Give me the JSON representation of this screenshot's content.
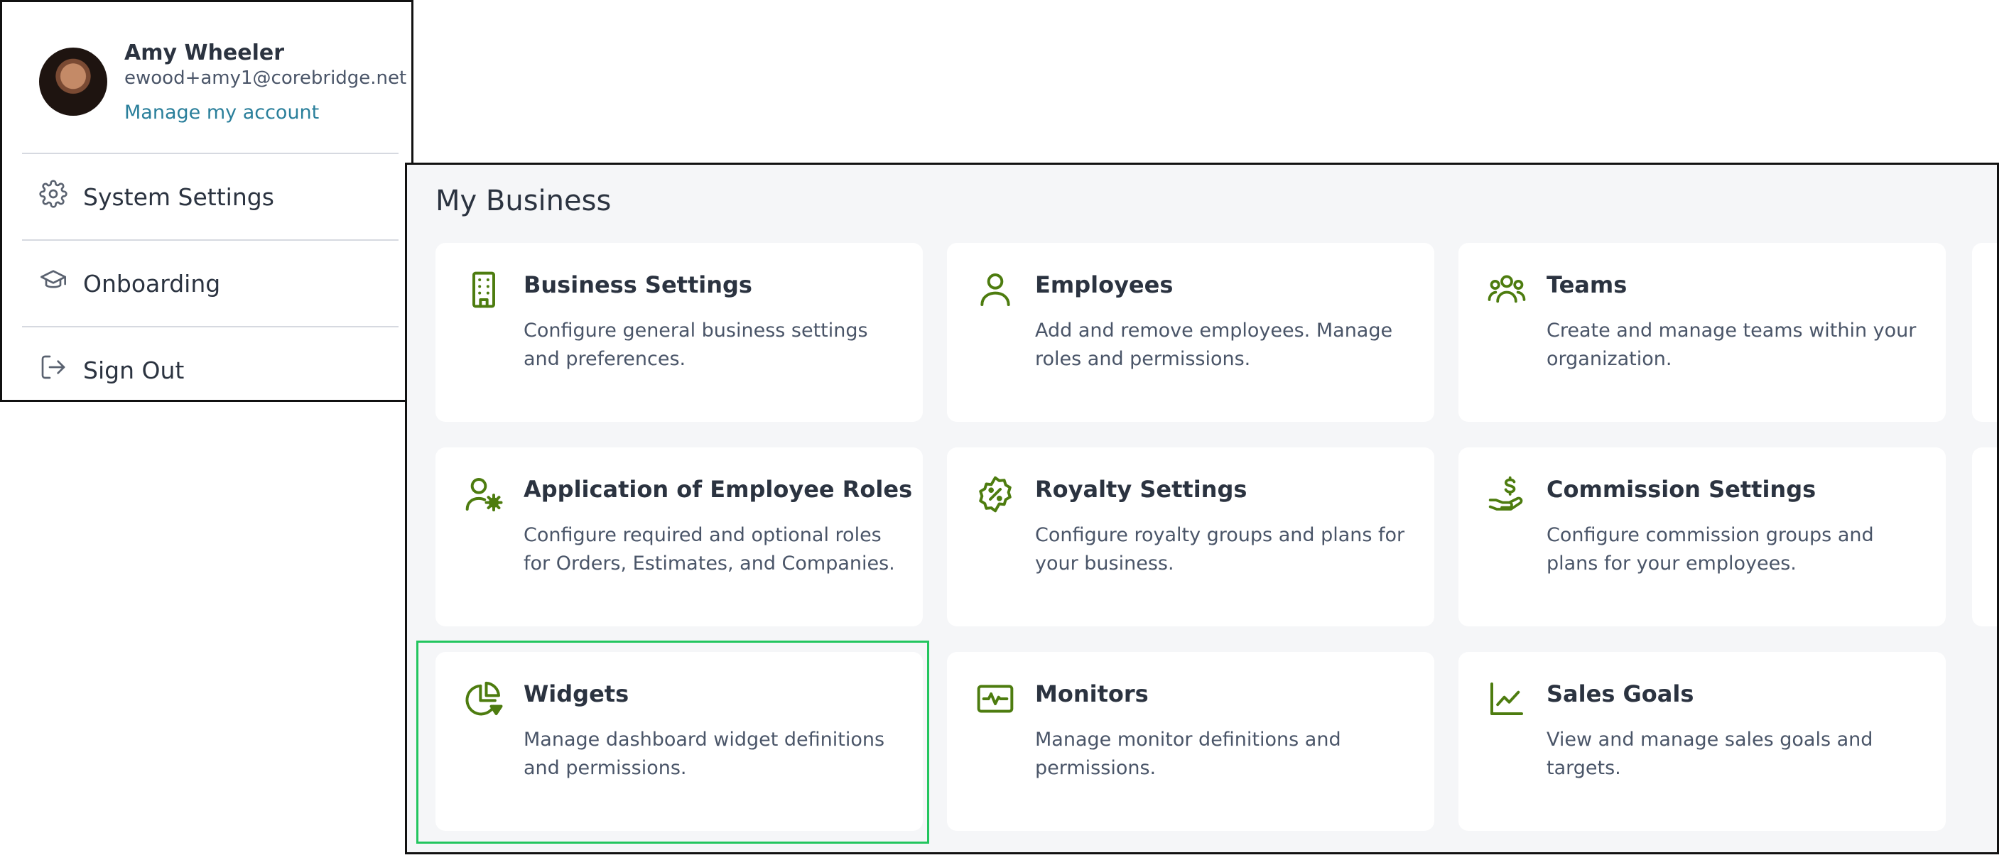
{
  "account": {
    "name": "Amy Wheeler",
    "email": "ewood+amy1@corebridge.net",
    "manage_link": "Manage my account",
    "menu": [
      {
        "label": "System Settings",
        "icon": "gear-icon"
      },
      {
        "label": "Onboarding",
        "icon": "graduation-cap-icon"
      },
      {
        "label": "Sign Out",
        "icon": "sign-out-icon"
      }
    ]
  },
  "business": {
    "title": "My Business",
    "accent_color": "#4d7c0f",
    "selection_color": "#22c55e",
    "cards": [
      {
        "title": "Business Settings",
        "desc": "Configure general business settings and preferences.",
        "icon": "building-icon"
      },
      {
        "title": "Employees",
        "desc": "Add and remove employees. Manage roles and permissions.",
        "icon": "user-icon"
      },
      {
        "title": "Teams",
        "desc": "Create and manage teams within your organization.",
        "icon": "users-icon"
      },
      {
        "title": "Application of Employee Roles",
        "desc": "Configure required and optional roles for Orders, Estimates, and Companies.",
        "icon": "user-cog-icon"
      },
      {
        "title": "Royalty Settings",
        "desc": "Configure royalty groups and plans for your business.",
        "icon": "percent-badge-icon"
      },
      {
        "title": "Commission Settings",
        "desc": "Configure commission groups and plans for your employees.",
        "icon": "hand-coin-icon"
      },
      {
        "title": "Widgets",
        "desc": "Manage dashboard widget definitions and permissions.",
        "icon": "pie-chart-icon"
      },
      {
        "title": "Monitors",
        "desc": "Manage monitor definitions and permissions.",
        "icon": "monitor-pulse-icon"
      },
      {
        "title": "Sales Goals",
        "desc": "View and manage sales goals and targets.",
        "icon": "line-chart-icon"
      }
    ]
  }
}
